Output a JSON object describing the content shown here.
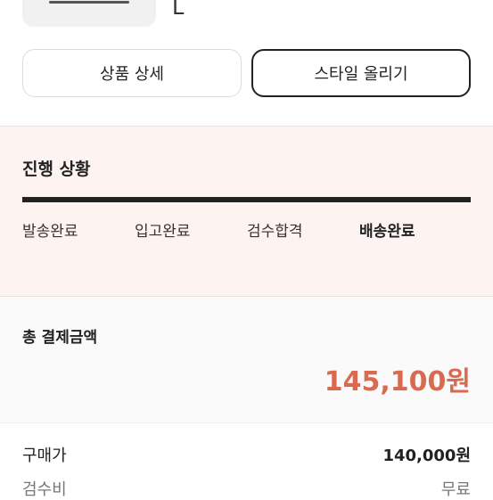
{
  "product": {
    "size": "L"
  },
  "buttons": {
    "detail": "상품 상세",
    "style": "스타일 올리기"
  },
  "progress": {
    "title": "진행 상황",
    "steps": [
      "발송완료",
      "입고완료",
      "검수합격",
      "배송완료"
    ],
    "current_step": "배송완료"
  },
  "payment": {
    "total_label": "총 결제금액",
    "total_amount": "145,100원",
    "rows": [
      {
        "label": "구매가",
        "value": "140,000원"
      },
      {
        "label": "검수비",
        "value": "무료"
      }
    ]
  },
  "colors": {
    "accent": "#d9694f",
    "progress_bg": "#fdf4f2"
  }
}
